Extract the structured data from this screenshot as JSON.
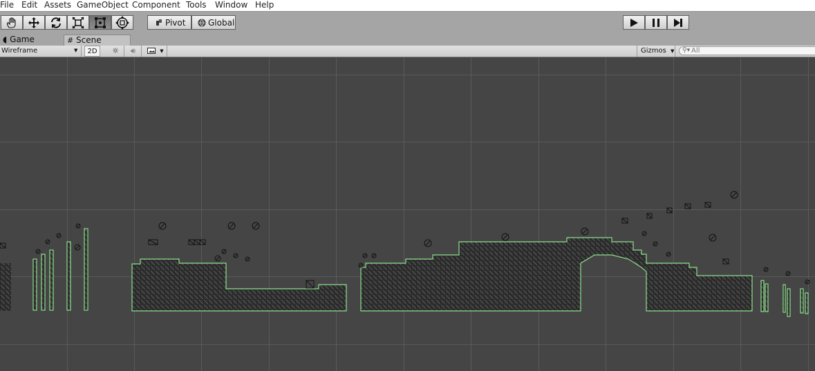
{
  "menu": [
    "File",
    "Edit",
    "Assets",
    "GameObject",
    "Component",
    "Tools",
    "Window",
    "Help"
  ],
  "toolbar": {
    "tools": [
      "hand-tool",
      "move-tool",
      "rotate-tool",
      "scale-tool",
      "rect-tool",
      "transform-tool"
    ],
    "active_tool": "rect-tool",
    "pivot_label": "Pivot",
    "global_label": "Global",
    "play_controls": [
      "play",
      "pause",
      "step"
    ]
  },
  "tabs": [
    {
      "label": "Game",
      "active": false
    },
    {
      "label": "Scene",
      "active": true
    }
  ],
  "scene_toolbar": {
    "shading_mode": "Wireframe",
    "mode_2d_label": "2D",
    "gizmos_label": "Gizmos",
    "search_placeholder": "All"
  },
  "colors": {
    "background": "#454545",
    "grid": "#5a5a5a",
    "terrain_fill": "#2e2e2e",
    "terrain_outline": "#8ee08e",
    "toolbar": "#a5a5a5"
  }
}
